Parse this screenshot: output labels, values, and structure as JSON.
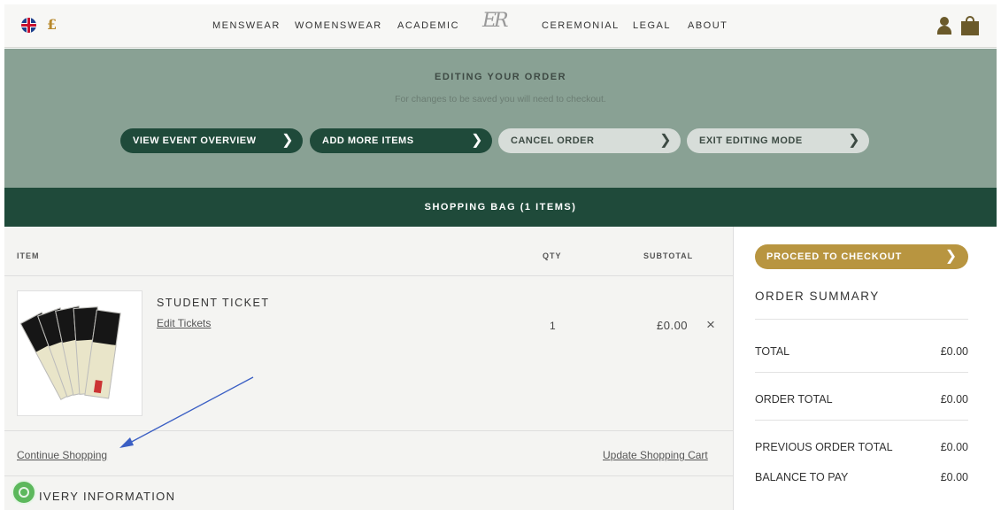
{
  "header": {
    "currency_symbol": "£",
    "nav": [
      "MENSWEAR",
      "WOMENSWEAR",
      "ACADEMIC",
      "CEREMONIAL",
      "LEGAL",
      "ABOUT"
    ],
    "logo": "ER"
  },
  "edit_banner": {
    "title": "EDITING YOUR ORDER",
    "subtitle": "For changes to be saved you will need to checkout.",
    "buttons": [
      {
        "label": "VIEW EVENT OVERVIEW",
        "icon": "chevron-right-icon"
      },
      {
        "label": "ADD MORE ITEMS",
        "icon": "chevron-right-icon"
      },
      {
        "label": "CANCEL ORDER",
        "icon": "chevron-right-icon"
      },
      {
        "label": "EXIT EDITING MODE",
        "icon": "chevron-right-icon"
      }
    ]
  },
  "bag_bar": {
    "title": "SHOPPING BAG (1 ITEMS)"
  },
  "cart": {
    "columns": {
      "item": "ITEM",
      "qty": "QTY",
      "subtotal": "SUBTOTAL"
    },
    "items": [
      {
        "name": "STUDENT TICKET",
        "edit_link": "Edit Tickets",
        "qty": "1",
        "subtotal": "£0.00",
        "remove": "×"
      }
    ],
    "continue_shopping": "Continue Shopping",
    "update_cart": "Update Shopping Cart",
    "delivery_heading": "IVERY INFORMATION"
  },
  "summary": {
    "checkout_label": "PROCEED TO CHECKOUT",
    "title": "ORDER SUMMARY",
    "rows": [
      {
        "label": "TOTAL",
        "value": "£0.00"
      },
      {
        "label": "ORDER TOTAL",
        "value": "£0.00"
      },
      {
        "label": "PREVIOUS ORDER TOTAL",
        "value": "£0.00"
      },
      {
        "label": "BALANCE TO PAY",
        "value": "£0.00"
      }
    ]
  },
  "colors": {
    "banner": "#89a194",
    "dark_green": "#1f4a3a",
    "gold": "#b89540",
    "annotation_arrow": "#3b5fc4"
  }
}
